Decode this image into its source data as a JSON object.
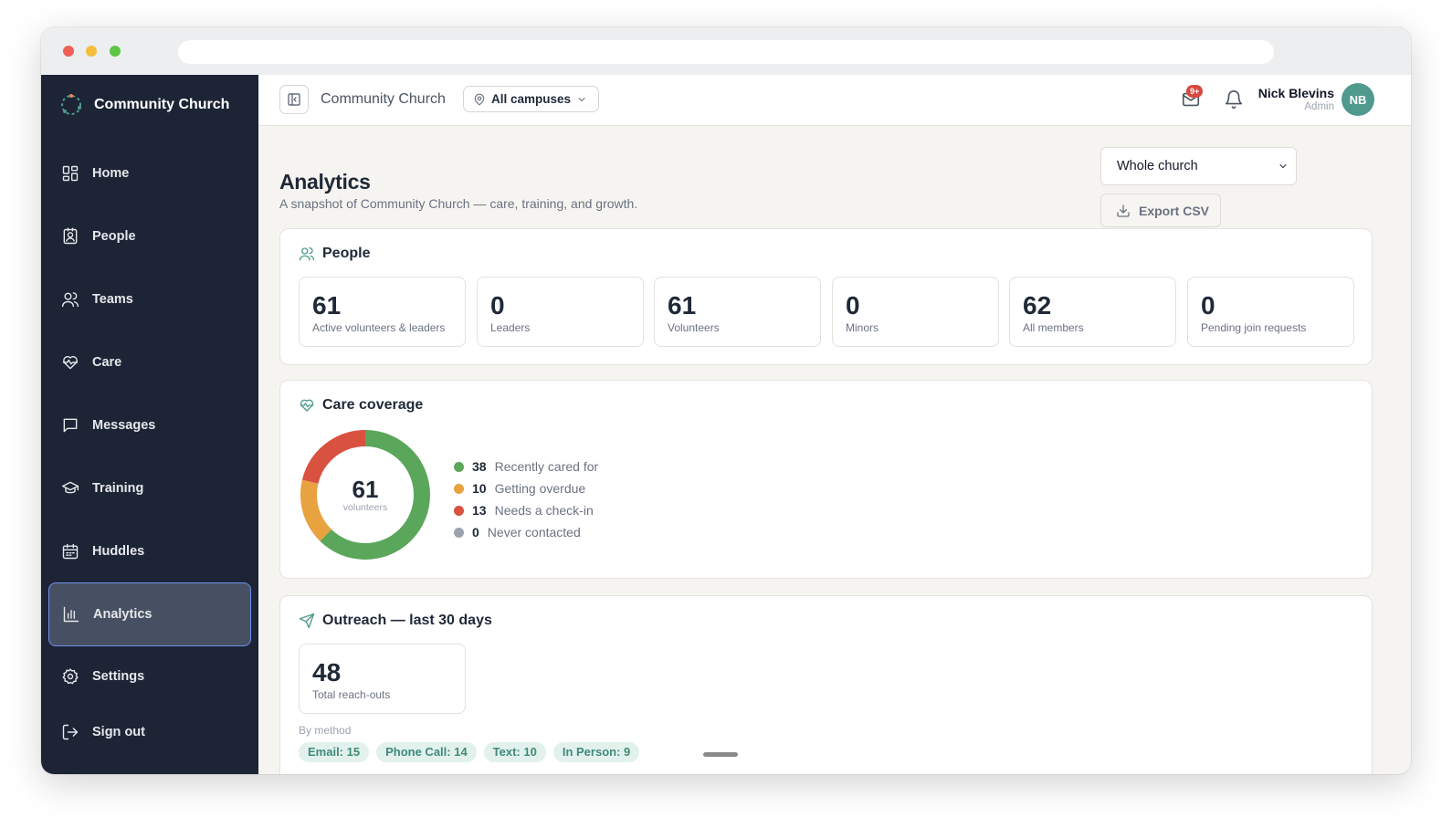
{
  "sidebar": {
    "brand": "Community Church",
    "items": [
      {
        "label": "Home",
        "icon": "grid-icon"
      },
      {
        "label": "People",
        "icon": "contact-icon"
      },
      {
        "label": "Teams",
        "icon": "users-icon"
      },
      {
        "label": "Care",
        "icon": "heart-pulse-icon"
      },
      {
        "label": "Messages",
        "icon": "message-icon"
      },
      {
        "label": "Training",
        "icon": "graduation-cap-icon"
      },
      {
        "label": "Huddles",
        "icon": "calendar-icon"
      },
      {
        "label": "Analytics",
        "icon": "bar-chart-icon",
        "active": true
      },
      {
        "label": "Settings",
        "icon": "gear-icon"
      },
      {
        "label": "Sign out",
        "icon": "sign-out-icon"
      }
    ]
  },
  "topbar": {
    "church": "Community Church",
    "campus": "All campuses",
    "mail_badge": "9+",
    "user_name": "Nick Blevins",
    "user_role": "Admin",
    "avatar_initials": "NB"
  },
  "page": {
    "title": "Analytics",
    "subtitle": "A snapshot of Community Church — care, training, and growth.",
    "scope": "Whole church",
    "export_label": "Export CSV"
  },
  "people": {
    "title": "People",
    "stats": [
      {
        "value": "61",
        "label": "Active volunteers & leaders"
      },
      {
        "value": "0",
        "label": "Leaders"
      },
      {
        "value": "61",
        "label": "Volunteers"
      },
      {
        "value": "0",
        "label": "Minors"
      },
      {
        "value": "62",
        "label": "All members"
      },
      {
        "value": "0",
        "label": "Pending join requests"
      }
    ]
  },
  "care": {
    "title": "Care coverage",
    "total": "61",
    "unit": "volunteers",
    "segments": [
      {
        "count": "38",
        "label": "Recently cared for",
        "color": "#5aa65a"
      },
      {
        "count": "10",
        "label": "Getting overdue",
        "color": "#e8a23f"
      },
      {
        "count": "13",
        "label": "Needs a check-in",
        "color": "#d9513f"
      },
      {
        "count": "0",
        "label": "Never contacted",
        "color": "#9ca3af"
      }
    ]
  },
  "outreach": {
    "title": "Outreach — last 30 days",
    "total": "48",
    "total_label": "Total reach-outs",
    "by_method_label": "By method",
    "methods": [
      "Email: 15",
      "Phone Call: 14",
      "Text: 10",
      "In Person: 9"
    ]
  },
  "colors": {
    "sidebar_bg": "#1c2435",
    "accent": "#4f9a8c",
    "active_border": "#6f8ff0"
  }
}
